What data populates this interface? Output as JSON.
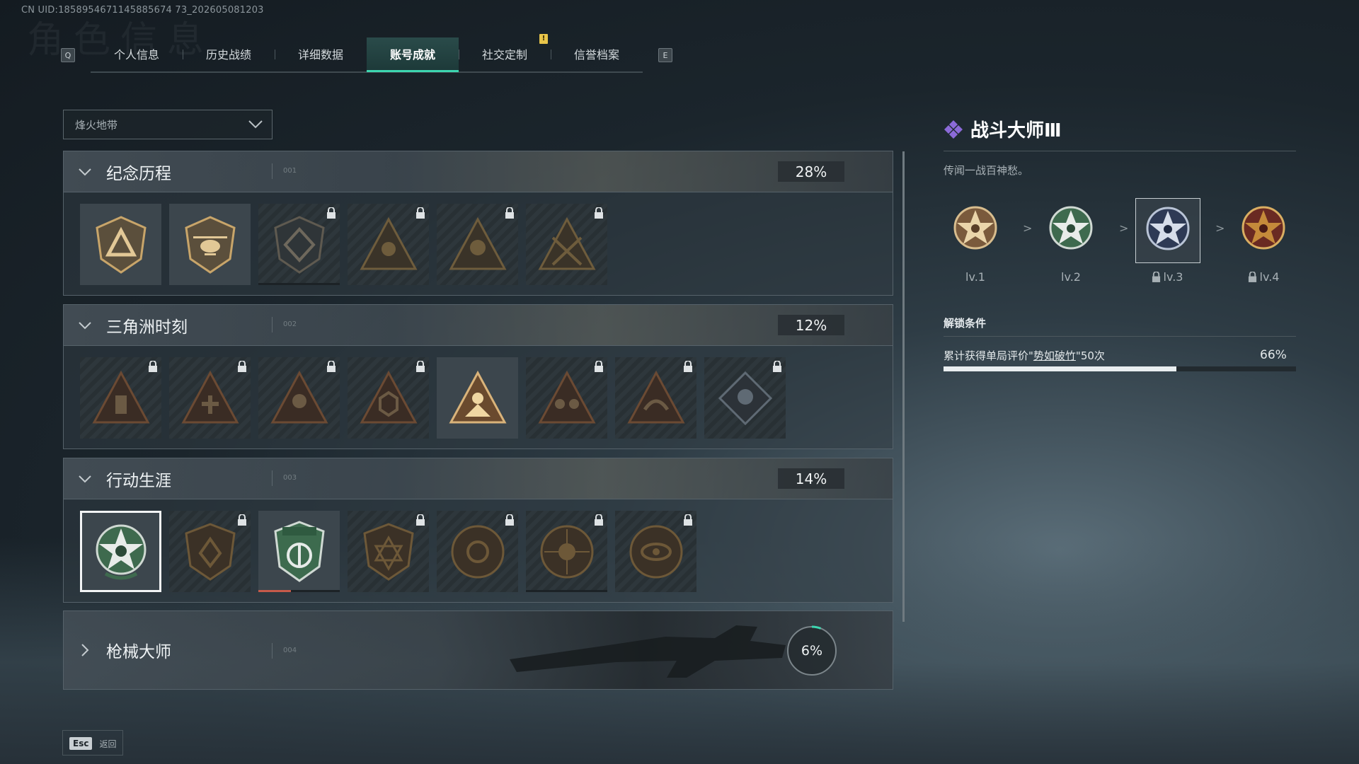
{
  "uid": "CN UID:1858954671145885674 73_202605081203",
  "header": {
    "ghost_title": "角色信息",
    "left_key": "Q",
    "right_key": "E",
    "tabs": [
      "个人信息",
      "历史战绩",
      "详细数据",
      "账号成就",
      "社交定制",
      "信誉档案"
    ],
    "active_tab": "账号成就",
    "notice_badge": "!"
  },
  "dropdown": {
    "value": "烽火地带"
  },
  "sections": [
    {
      "title": "纪念历程",
      "num": "001",
      "percent": "28%",
      "expanded": true
    },
    {
      "title": "三角洲时刻",
      "num": "002",
      "percent": "12%",
      "expanded": true
    },
    {
      "title": "行动生涯",
      "num": "003",
      "percent": "14%",
      "expanded": true
    },
    {
      "title": "枪械大师",
      "num": "004",
      "percent": "6%",
      "expanded": false,
      "progress": 0.06
    }
  ],
  "detail": {
    "title": "战斗大师Ⅲ",
    "description": "传闻一战百神愁。",
    "levels": [
      "lv.1",
      "lv.2",
      "lv.3",
      "lv.4"
    ],
    "separator": ">",
    "unlock_title": "解锁条件",
    "condition_prefix": "累计获得单局评价\"",
    "condition_keyword": "势如破竹",
    "condition_suffix": "\"50次",
    "progress_text": "66%",
    "progress": 0.66
  },
  "footer": {
    "esc_key": "Esc",
    "back_label": "返回"
  },
  "colors": {
    "accent": "#3dd6b0",
    "badge": "#e8c54a",
    "detail_icon": "#8b6ad8"
  }
}
